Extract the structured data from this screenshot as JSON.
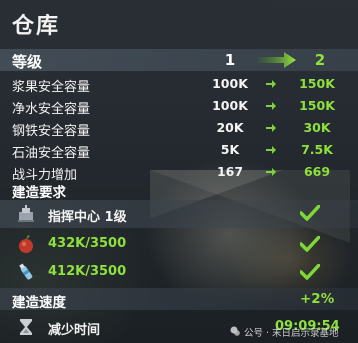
{
  "title": "仓库",
  "level": {
    "label": "等级",
    "current": "1",
    "next": "2"
  },
  "stats": [
    {
      "label": "浆果安全容量",
      "current": "100K",
      "next": "150K"
    },
    {
      "label": "净水安全容量",
      "current": "100K",
      "next": "150K"
    },
    {
      "label": "钢铁安全容量",
      "current": "20K",
      "next": "30K"
    },
    {
      "label": "石油安全容量",
      "current": "5K",
      "next": "7.5K"
    },
    {
      "label": "战斗力增加",
      "current": "167",
      "next": "669"
    }
  ],
  "requirements": {
    "label": "建造要求",
    "items": [
      {
        "text": "指挥中心 1级",
        "icon": "command-center-icon"
      },
      {
        "text": "432K/3500",
        "icon": "berry-icon"
      },
      {
        "text": "412K/3500",
        "icon": "water-bottle-icon"
      }
    ]
  },
  "speed": {
    "label": "建造速度",
    "value": "+2%"
  },
  "time": {
    "label": "减少时间",
    "value": "09:09:54"
  },
  "watermark": "公号 · 末日启示录基地",
  "colors": {
    "accent_green": "#8ee03c",
    "text": "#f4f4f4",
    "band": "#46505a"
  }
}
